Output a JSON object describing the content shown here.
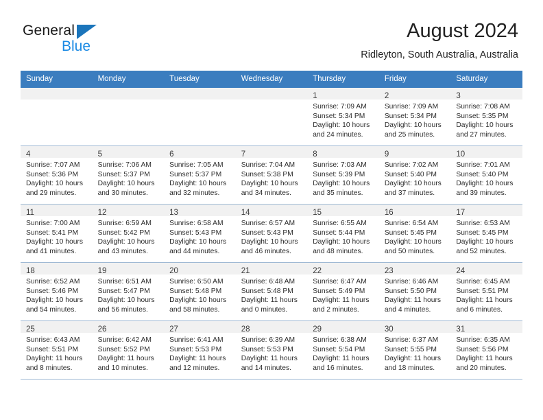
{
  "brand": {
    "name_primary": "General",
    "name_secondary": "Blue",
    "logo_icon": "triangle-logo-icon"
  },
  "header": {
    "title": "August 2024",
    "subtitle": "Ridleyton, South Australia, Australia"
  },
  "colors": {
    "header_blue": "#3b7dbf",
    "brand_blue": "#1b8ae4",
    "logo_blue": "#1b75bb",
    "daynum_band": "#f1f1f1",
    "row_border": "#9fb9d4"
  },
  "weekday_headers": [
    "Sunday",
    "Monday",
    "Tuesday",
    "Wednesday",
    "Thursday",
    "Friday",
    "Saturday"
  ],
  "weeks": [
    [
      {
        "day": "",
        "lines": []
      },
      {
        "day": "",
        "lines": []
      },
      {
        "day": "",
        "lines": []
      },
      {
        "day": "",
        "lines": []
      },
      {
        "day": "1",
        "lines": [
          "Sunrise: 7:09 AM",
          "Sunset: 5:34 PM",
          "Daylight: 10 hours",
          "and 24 minutes."
        ]
      },
      {
        "day": "2",
        "lines": [
          "Sunrise: 7:09 AM",
          "Sunset: 5:34 PM",
          "Daylight: 10 hours",
          "and 25 minutes."
        ]
      },
      {
        "day": "3",
        "lines": [
          "Sunrise: 7:08 AM",
          "Sunset: 5:35 PM",
          "Daylight: 10 hours",
          "and 27 minutes."
        ]
      }
    ],
    [
      {
        "day": "4",
        "lines": [
          "Sunrise: 7:07 AM",
          "Sunset: 5:36 PM",
          "Daylight: 10 hours",
          "and 29 minutes."
        ]
      },
      {
        "day": "5",
        "lines": [
          "Sunrise: 7:06 AM",
          "Sunset: 5:37 PM",
          "Daylight: 10 hours",
          "and 30 minutes."
        ]
      },
      {
        "day": "6",
        "lines": [
          "Sunrise: 7:05 AM",
          "Sunset: 5:37 PM",
          "Daylight: 10 hours",
          "and 32 minutes."
        ]
      },
      {
        "day": "7",
        "lines": [
          "Sunrise: 7:04 AM",
          "Sunset: 5:38 PM",
          "Daylight: 10 hours",
          "and 34 minutes."
        ]
      },
      {
        "day": "8",
        "lines": [
          "Sunrise: 7:03 AM",
          "Sunset: 5:39 PM",
          "Daylight: 10 hours",
          "and 35 minutes."
        ]
      },
      {
        "day": "9",
        "lines": [
          "Sunrise: 7:02 AM",
          "Sunset: 5:40 PM",
          "Daylight: 10 hours",
          "and 37 minutes."
        ]
      },
      {
        "day": "10",
        "lines": [
          "Sunrise: 7:01 AM",
          "Sunset: 5:40 PM",
          "Daylight: 10 hours",
          "and 39 minutes."
        ]
      }
    ],
    [
      {
        "day": "11",
        "lines": [
          "Sunrise: 7:00 AM",
          "Sunset: 5:41 PM",
          "Daylight: 10 hours",
          "and 41 minutes."
        ]
      },
      {
        "day": "12",
        "lines": [
          "Sunrise: 6:59 AM",
          "Sunset: 5:42 PM",
          "Daylight: 10 hours",
          "and 43 minutes."
        ]
      },
      {
        "day": "13",
        "lines": [
          "Sunrise: 6:58 AM",
          "Sunset: 5:43 PM",
          "Daylight: 10 hours",
          "and 44 minutes."
        ]
      },
      {
        "day": "14",
        "lines": [
          "Sunrise: 6:57 AM",
          "Sunset: 5:43 PM",
          "Daylight: 10 hours",
          "and 46 minutes."
        ]
      },
      {
        "day": "15",
        "lines": [
          "Sunrise: 6:55 AM",
          "Sunset: 5:44 PM",
          "Daylight: 10 hours",
          "and 48 minutes."
        ]
      },
      {
        "day": "16",
        "lines": [
          "Sunrise: 6:54 AM",
          "Sunset: 5:45 PM",
          "Daylight: 10 hours",
          "and 50 minutes."
        ]
      },
      {
        "day": "17",
        "lines": [
          "Sunrise: 6:53 AM",
          "Sunset: 5:45 PM",
          "Daylight: 10 hours",
          "and 52 minutes."
        ]
      }
    ],
    [
      {
        "day": "18",
        "lines": [
          "Sunrise: 6:52 AM",
          "Sunset: 5:46 PM",
          "Daylight: 10 hours",
          "and 54 minutes."
        ]
      },
      {
        "day": "19",
        "lines": [
          "Sunrise: 6:51 AM",
          "Sunset: 5:47 PM",
          "Daylight: 10 hours",
          "and 56 minutes."
        ]
      },
      {
        "day": "20",
        "lines": [
          "Sunrise: 6:50 AM",
          "Sunset: 5:48 PM",
          "Daylight: 10 hours",
          "and 58 minutes."
        ]
      },
      {
        "day": "21",
        "lines": [
          "Sunrise: 6:48 AM",
          "Sunset: 5:48 PM",
          "Daylight: 11 hours",
          "and 0 minutes."
        ]
      },
      {
        "day": "22",
        "lines": [
          "Sunrise: 6:47 AM",
          "Sunset: 5:49 PM",
          "Daylight: 11 hours",
          "and 2 minutes."
        ]
      },
      {
        "day": "23",
        "lines": [
          "Sunrise: 6:46 AM",
          "Sunset: 5:50 PM",
          "Daylight: 11 hours",
          "and 4 minutes."
        ]
      },
      {
        "day": "24",
        "lines": [
          "Sunrise: 6:45 AM",
          "Sunset: 5:51 PM",
          "Daylight: 11 hours",
          "and 6 minutes."
        ]
      }
    ],
    [
      {
        "day": "25",
        "lines": [
          "Sunrise: 6:43 AM",
          "Sunset: 5:51 PM",
          "Daylight: 11 hours",
          "and 8 minutes."
        ]
      },
      {
        "day": "26",
        "lines": [
          "Sunrise: 6:42 AM",
          "Sunset: 5:52 PM",
          "Daylight: 11 hours",
          "and 10 minutes."
        ]
      },
      {
        "day": "27",
        "lines": [
          "Sunrise: 6:41 AM",
          "Sunset: 5:53 PM",
          "Daylight: 11 hours",
          "and 12 minutes."
        ]
      },
      {
        "day": "28",
        "lines": [
          "Sunrise: 6:39 AM",
          "Sunset: 5:53 PM",
          "Daylight: 11 hours",
          "and 14 minutes."
        ]
      },
      {
        "day": "29",
        "lines": [
          "Sunrise: 6:38 AM",
          "Sunset: 5:54 PM",
          "Daylight: 11 hours",
          "and 16 minutes."
        ]
      },
      {
        "day": "30",
        "lines": [
          "Sunrise: 6:37 AM",
          "Sunset: 5:55 PM",
          "Daylight: 11 hours",
          "and 18 minutes."
        ]
      },
      {
        "day": "31",
        "lines": [
          "Sunrise: 6:35 AM",
          "Sunset: 5:56 PM",
          "Daylight: 11 hours",
          "and 20 minutes."
        ]
      }
    ]
  ]
}
